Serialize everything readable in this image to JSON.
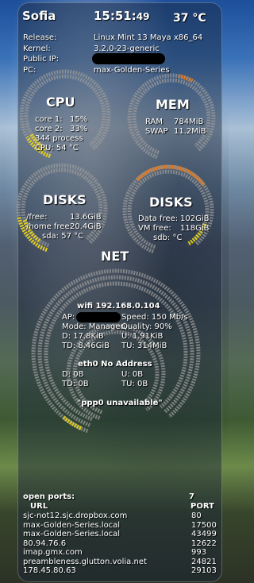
{
  "header": {
    "hostname": "Sofia",
    "time_main": "15:51:",
    "time_sec": "49",
    "temperature": "37 °C"
  },
  "system": {
    "release_label": "Release:",
    "release_value": "Linux Mint 13 Maya  x86_64",
    "kernel_label": "Kernel:",
    "kernel_value": "3.2.0-23-generic",
    "public_ip_label": "Public IP:",
    "pc_label": "PC:",
    "pc_value": "max-Golden-Series"
  },
  "cpu": {
    "title": "CPU",
    "core1_label": "core 1:",
    "core1_value": "15%",
    "core2_label": "core 2:",
    "core2_value": "33%",
    "processes": "344 process",
    "temp": "CPU: 54 °C",
    "core1_level": 0.15,
    "core2_level": 0.33
  },
  "mem": {
    "title": "MEM",
    "ram_label": "RAM",
    "ram_value": "784MiB",
    "swap_label": "SWAP",
    "swap_value": "11.2MiB",
    "ram_level": 0.2
  },
  "disks_left": {
    "title": "DISKS",
    "free_label": "/free:",
    "free_value": "13.6GiB",
    "home_label": "/home free:",
    "home_value": "20.4GiB",
    "temp": "sda: 57 °C"
  },
  "disks_right": {
    "title": "DISKS",
    "data_label": "Data free:",
    "data_value": "102GiB",
    "vm_label": "VM free:",
    "vm_value": "118GiB",
    "temp": "sdb:  °C"
  },
  "net": {
    "title": "NET",
    "wifi": {
      "title": "wifi 192.168.0.104",
      "ap_label": "AP:",
      "speed": "Speed: 150 Mb/s",
      "mode": "Mode: Managed",
      "quality": "Quality: 90%",
      "down": "D: 17.8KiB",
      "up": "U: 1.91KiB",
      "total_down": "TD: 8.46GiB",
      "total_up": "TU: 314MiB"
    },
    "eth0": {
      "title": "eth0 No Address",
      "down": "D: 0B",
      "up": "U: 0B",
      "total_down": "TD: 0B",
      "total_up": "TU: 0B"
    },
    "ppp0": "\"ppp0 unavailable\""
  },
  "ports": {
    "title": "open ports:",
    "count": "7",
    "url_header": "URL",
    "port_header": "PORT",
    "rows": [
      {
        "url": "sjc-not12.sjc.dropbox.com",
        "port": "80"
      },
      {
        "url": "max-Golden-Series.local",
        "port": "17500"
      },
      {
        "url": "max-Golden-Series.local",
        "port": "43499"
      },
      {
        "url": "80.94.76.6",
        "port": "12622"
      },
      {
        "url": "imap.gmx.com",
        "port": "993"
      },
      {
        "url": "preambleness.glutton.volia.net",
        "port": "24821"
      },
      {
        "url": "178.45.80.63",
        "port": "29103"
      }
    ]
  },
  "colors": {
    "accent_yellow": "#e8d21a",
    "accent_orange": "#e87a1a",
    "ring_grey": "#9a9a9a"
  }
}
